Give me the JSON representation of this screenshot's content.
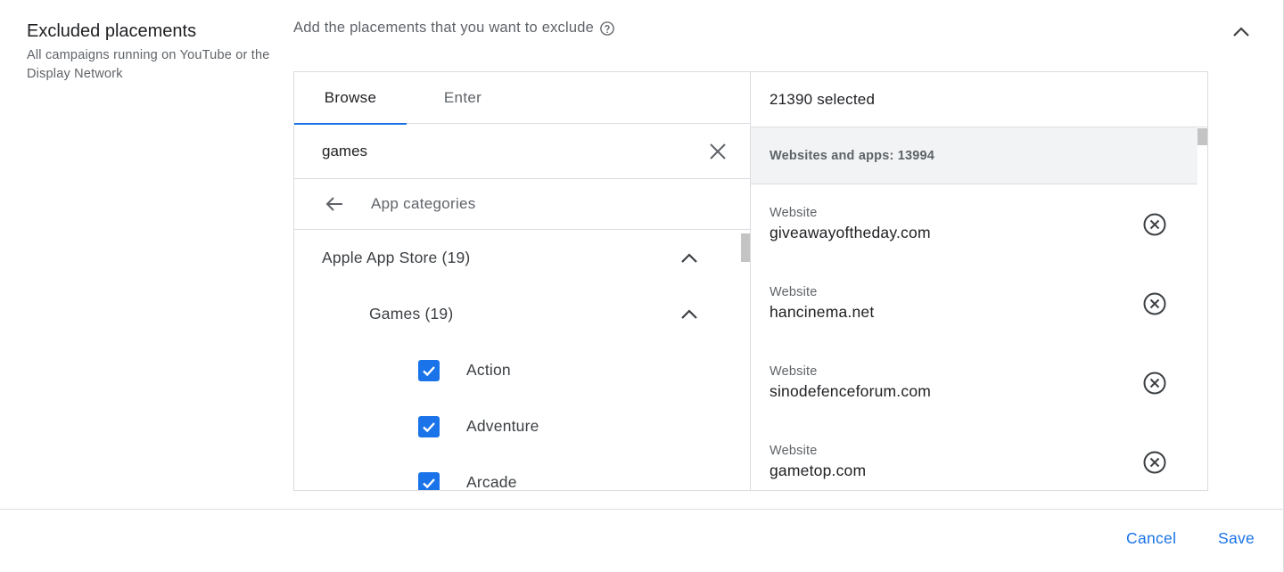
{
  "section": {
    "title": "Excluded placements",
    "subtitle": "All campaigns running on YouTube or the Display Network"
  },
  "instruction": "Add the placements that you want to exclude",
  "browse": {
    "tabs": [
      {
        "label": "Browse",
        "active": true
      },
      {
        "label": "Enter",
        "active": false
      }
    ],
    "search_value": "games",
    "back_label": "App categories",
    "tree": [
      {
        "label": "Apple App Store (19)",
        "level": 1,
        "expanded": true
      },
      {
        "label": "Games (19)",
        "level": 2,
        "expanded": true
      },
      {
        "label": "Action",
        "level": 3,
        "checked": true
      },
      {
        "label": "Adventure",
        "level": 3,
        "checked": true
      },
      {
        "label": "Arcade",
        "level": 3,
        "checked": true
      }
    ]
  },
  "selected": {
    "count_label": "21390 selected",
    "group_label": "Websites and apps: 13994",
    "items": [
      {
        "type": "Website",
        "url": "giveawayoftheday.com"
      },
      {
        "type": "Website",
        "url": "hancinema.net"
      },
      {
        "type": "Website",
        "url": "sinodefenceforum.com"
      },
      {
        "type": "Website",
        "url": "gametop.com"
      }
    ]
  },
  "footer": {
    "cancel_label": "Cancel",
    "save_label": "Save"
  },
  "colors": {
    "accent": "#1a73e8",
    "text_primary": "#202124",
    "text_secondary": "#5f6368",
    "divider": "#dadce0"
  },
  "icons": {
    "help": "help-circle-icon",
    "collapse": "chevron-up-icon",
    "clear": "close-icon",
    "back": "arrow-back-icon",
    "check": "check-icon",
    "remove": "cancel-circle-icon"
  }
}
